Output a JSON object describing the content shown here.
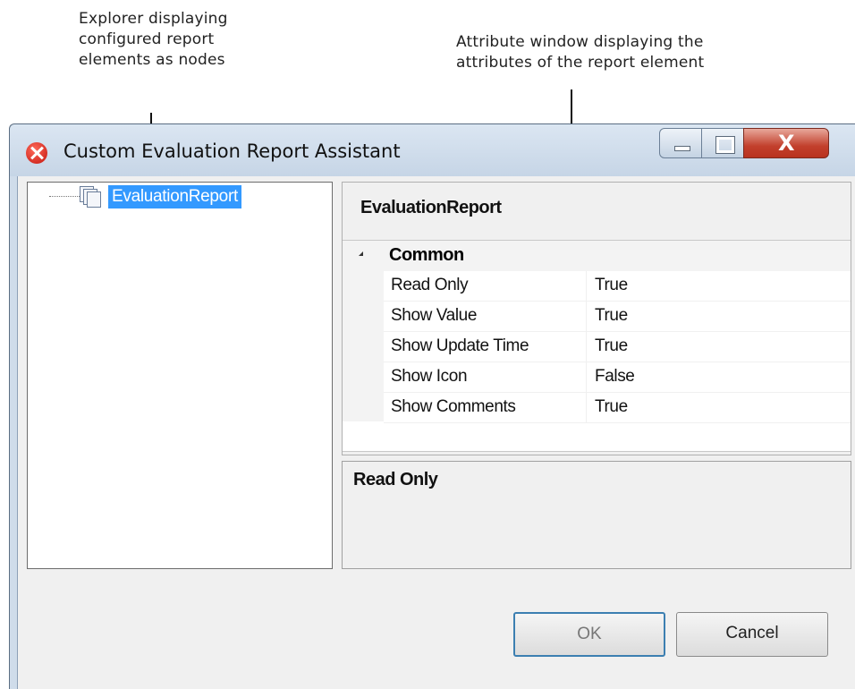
{
  "annotations": {
    "explorer_note": "Explorer displaying\nconfigured report\nelements as nodes",
    "attribute_note": "Attribute window displaying the\nattributes of the report element"
  },
  "window": {
    "title": "Custom Evaluation Report Assistant",
    "close_glyph": "X"
  },
  "explorer": {
    "nodes": [
      {
        "label": "EvaluationReport",
        "selected": true,
        "icon": "report-node-icon"
      }
    ]
  },
  "attributes": {
    "heading": "EvaluationReport",
    "category": "Common",
    "properties": [
      {
        "name": "Read Only",
        "value": "True"
      },
      {
        "name": "Show Value",
        "value": "True"
      },
      {
        "name": "Show Update Time",
        "value": "True"
      },
      {
        "name": "Show Icon",
        "value": "False"
      },
      {
        "name": "Show Comments",
        "value": "True"
      }
    ]
  },
  "description": {
    "title": "Read Only"
  },
  "buttons": {
    "ok": "OK",
    "cancel": "Cancel"
  },
  "colors": {
    "selection": "#3399ff",
    "close_button": "#c2402d",
    "window_frame": "#cfdcea"
  }
}
